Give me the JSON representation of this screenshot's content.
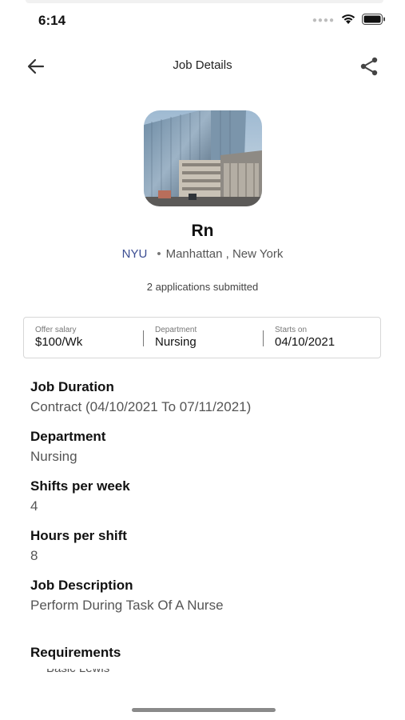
{
  "status_bar": {
    "time": "6:14"
  },
  "nav": {
    "title": "Job Details"
  },
  "job": {
    "title": "Rn",
    "organization": "NYU",
    "separator": "•",
    "location": "Manhattan , New York",
    "applications": "2 applications submitted"
  },
  "summary": [
    {
      "label": "Offer salary",
      "value": "$100/Wk"
    },
    {
      "label": "Department",
      "value": "Nursing"
    },
    {
      "label": "Starts on",
      "value": "04/10/2021"
    }
  ],
  "details": [
    {
      "heading": "Job Duration",
      "value": "Contract (04/10/2021 To 07/11/2021)"
    },
    {
      "heading": "Department",
      "value": "Nursing"
    },
    {
      "heading": "Shifts per week",
      "value": "4"
    },
    {
      "heading": "Hours per shift",
      "value": "8"
    },
    {
      "heading": "Job Description",
      "value": "Perform During Task Of A Nurse"
    }
  ],
  "requirements": {
    "heading": "Requirements",
    "first_item_peek": "Basic Lewis"
  },
  "colors": {
    "accent_org": "#3c4e93",
    "text_primary": "#111111",
    "text_secondary": "#555555"
  },
  "icons": {
    "back": "arrow-left-icon",
    "share": "share-icon",
    "wifi": "wifi-icon",
    "battery": "battery-icon"
  }
}
